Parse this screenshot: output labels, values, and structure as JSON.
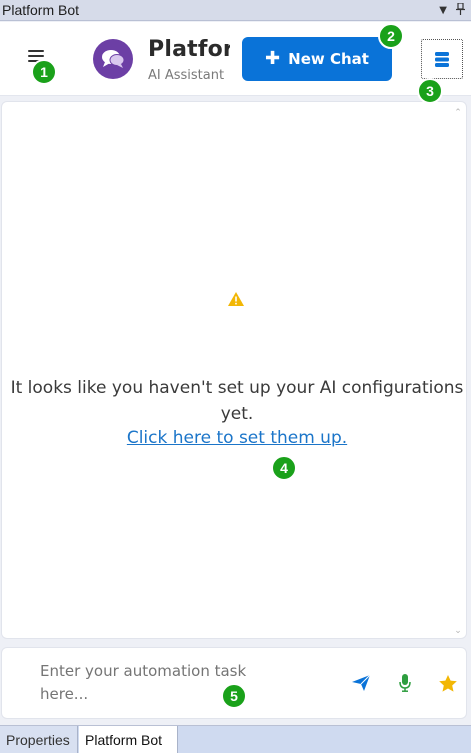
{
  "window": {
    "title": "Platform Bot"
  },
  "header": {
    "brand_title": "Platform Bot",
    "brand_subtitle": "AI Assistant",
    "new_chat_label": "New Chat"
  },
  "chat": {
    "warning_message": "It looks like you haven't set up your AI configurations yet.",
    "setup_link": "Click here to set them up."
  },
  "input": {
    "placeholder": "Enter your automation task here..."
  },
  "badges": [
    "1",
    "2",
    "3",
    "4",
    "5"
  ],
  "tabs": [
    {
      "label": "Properties",
      "active": false
    },
    {
      "label": "Platform Bot",
      "active": true
    }
  ],
  "colors": {
    "accent": "#0a73d8",
    "logo": "#6c3fa5",
    "badge": "#1aa11a",
    "link": "#1b75c9",
    "warning": "#f2b705",
    "mic": "#2e9e3f",
    "star": "#f2b705"
  },
  "icons": [
    "menu-icon",
    "chat-bubbles-icon",
    "plus-icon",
    "database-icon",
    "warning-icon",
    "send-icon",
    "microphone-icon",
    "star-icon"
  ]
}
